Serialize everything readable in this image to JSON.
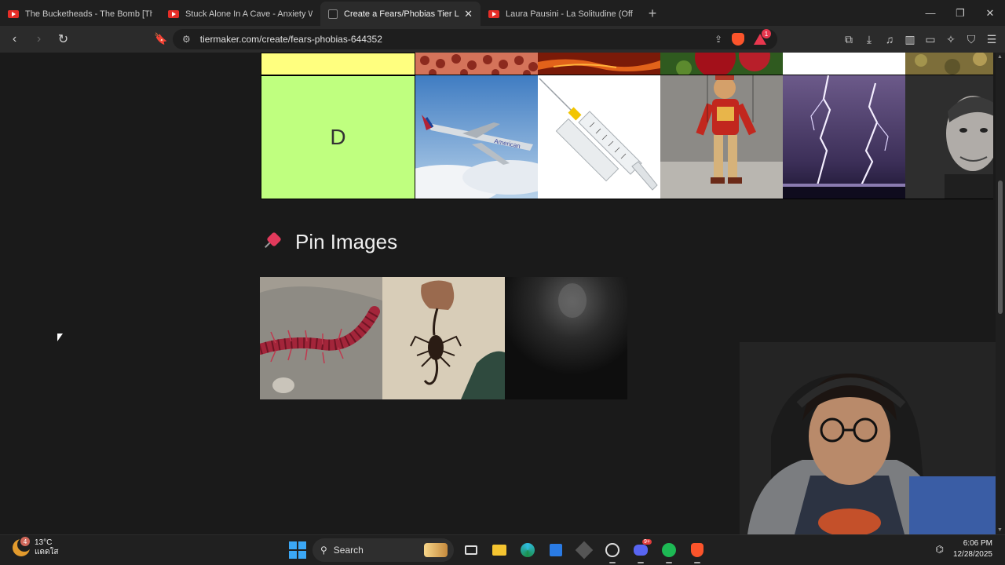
{
  "browser": {
    "tabs": [
      {
        "title": "The Bucketheads - The Bomb [These",
        "favicon": "youtube-icon",
        "active": false
      },
      {
        "title": "Stuck Alone In A Cave - Anxiety Warr",
        "favicon": "youtube-icon",
        "active": false
      },
      {
        "title": "Create a Fears/Phobias Tier List",
        "favicon": "tiermaker-icon",
        "active": true
      },
      {
        "title": "Laura Pausini - La Solitudine (Official",
        "favicon": "youtube-icon",
        "active": false
      }
    ],
    "url": "tiermaker.com/create/fears-phobias-644352",
    "rewards_badge": "1"
  },
  "tierlist": {
    "rows": [
      {
        "label": "",
        "color": "#ffff7f",
        "items": [
          "lotus-seed-holes",
          "lava",
          "strawberry-seeds",
          "white",
          "moss"
        ]
      },
      {
        "label": "D",
        "color": "#bfff7f",
        "items": [
          "airplane",
          "syringe",
          "marionette",
          "lightning",
          "man-portrait"
        ]
      }
    ],
    "pin_section_title": "Pin Images",
    "pin_items": [
      "centipede",
      "scorpion",
      "dark-ghost"
    ]
  },
  "taskbar": {
    "weather_temp": "13°C",
    "weather_desc": "แดดใส",
    "weather_badge": "4",
    "search_placeholder": "Search",
    "discord_badge": "9+",
    "time": "6:06 PM",
    "date": "12/28/2025"
  }
}
